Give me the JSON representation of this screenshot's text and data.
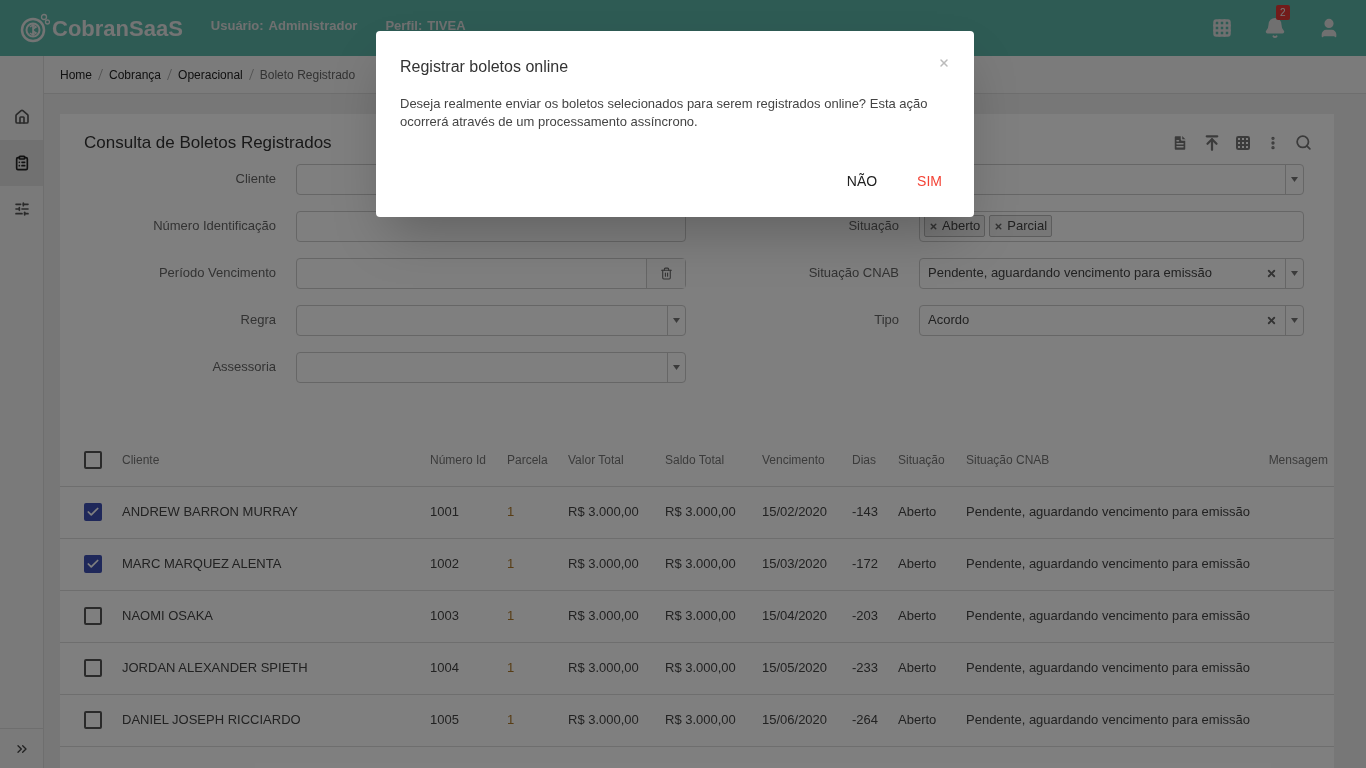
{
  "header": {
    "logo_text": "CobranSaaS",
    "user_label": "Usuário:",
    "user_value": "Administrador",
    "profile_label": "Perfil:",
    "profile_value": "TIVEA",
    "notification_count": "2"
  },
  "sidebar": {
    "items": [
      {
        "kind": "home",
        "selected": false
      },
      {
        "kind": "clipboard",
        "selected": true
      },
      {
        "kind": "sliders",
        "selected": false
      }
    ]
  },
  "breadcrumb": [
    {
      "label": "Home",
      "current": false
    },
    {
      "label": "Cobrança",
      "current": false
    },
    {
      "label": "Operacional",
      "current": false
    },
    {
      "label": "Boleto Registrado",
      "current": true
    }
  ],
  "card": {
    "title": "Consulta de Boletos Registrados"
  },
  "filters_left": [
    {
      "label": "Cliente",
      "kind": "text"
    },
    {
      "label": "Número Identificação",
      "kind": "text"
    },
    {
      "label": "Período Vencimento",
      "kind": "date"
    },
    {
      "label": "Regra",
      "kind": "select"
    },
    {
      "label": "Assessoria",
      "kind": "select"
    }
  ],
  "filters_right": [
    {
      "kind": "select"
    },
    {
      "label": "Situação",
      "kind": "tags",
      "tags": [
        "Aberto",
        "Parcial"
      ]
    },
    {
      "label": "Situação CNAB",
      "kind": "select",
      "value": "Pendente, aguardando vencimento para emissão"
    },
    {
      "label": "Tipo",
      "kind": "select",
      "value": "Acordo"
    }
  ],
  "table": {
    "select_all_checked": false,
    "columns": [
      "Cliente",
      "Número Id",
      "Parcela",
      "Valor Total",
      "Saldo Total",
      "Vencimento",
      "Dias",
      "Situação",
      "Situação CNAB",
      "Mensagem"
    ],
    "rows": [
      {
        "checked": true,
        "cells": [
          "ANDREW BARRON MURRAY",
          "1001",
          "1",
          "R$ 3.000,00",
          "R$ 3.000,00",
          "15/02/2020",
          "-143",
          "Aberto",
          "Pendente, aguardando vencimento para emissão"
        ]
      },
      {
        "checked": true,
        "cells": [
          "MARC MARQUEZ ALENTA",
          "1002",
          "1",
          "R$ 3.000,00",
          "R$ 3.000,00",
          "15/03/2020",
          "-172",
          "Aberto",
          "Pendente, aguardando vencimento para emissão"
        ]
      },
      {
        "checked": false,
        "cells": [
          "NAOMI OSAKA",
          "1003",
          "1",
          "R$ 3.000,00",
          "R$ 3.000,00",
          "15/04/2020",
          "-203",
          "Aberto",
          "Pendente, aguardando vencimento para emissão"
        ]
      },
      {
        "checked": false,
        "cells": [
          "JORDAN ALEXANDER SPIETH",
          "1004",
          "1",
          "R$ 3.000,00",
          "R$ 3.000,00",
          "15/05/2020",
          "-233",
          "Aberto",
          "Pendente, aguardando vencimento para emissão"
        ]
      },
      {
        "checked": false,
        "cells": [
          "DANIEL JOSEPH RICCIARDO",
          "1005",
          "1",
          "R$ 3.000,00",
          "R$ 3.000,00",
          "15/06/2020",
          "-264",
          "Aberto",
          "Pendente, aguardando vencimento para emissão"
        ]
      }
    ]
  },
  "modal": {
    "title": "Registrar boletos online",
    "message": "Deseja realmente enviar os boletos selecionados para serem registrados online? Esta ação ocorrerá através de um processamento assíncrono.",
    "buttons": [
      {
        "label": "NÃO",
        "kind": "cancel"
      },
      {
        "label": "SIM",
        "kind": "confirm"
      }
    ]
  }
}
